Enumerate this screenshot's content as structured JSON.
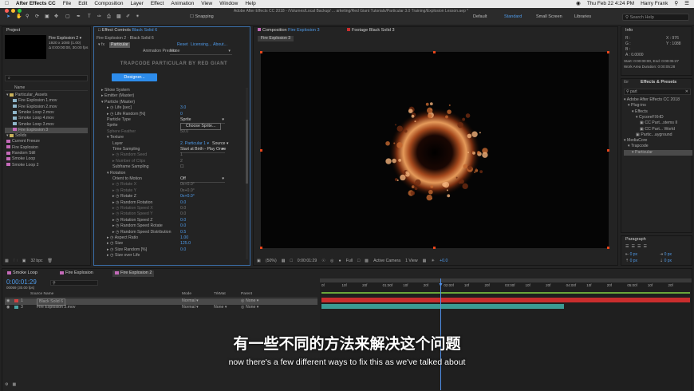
{
  "menubar": {
    "app": "After Effects CC",
    "items": [
      "File",
      "Edit",
      "Composition",
      "Layer",
      "Effect",
      "Animation",
      "View",
      "Window",
      "Help"
    ],
    "datetime": "Thu Feb 22  4:24 PM",
    "user": "Harry Frank"
  },
  "title": "Adobe After Effects CC 2018 - /Volumes/Local Backup/ ... arketing/Red Giant Tutorials/Particular 3.0 Training/Explosion Lesson.aep *",
  "toolbar": {
    "snapping": "Snapping",
    "workspaces": [
      "Default",
      "Standard",
      "Small Screen",
      "Libraries"
    ],
    "search_placeholder": "Search Help"
  },
  "project": {
    "tab": "Project",
    "item_name": "Fire Explosion 2 ▾",
    "item_size": "1920 x 1080 (1.00)",
    "item_dur": "Δ 0:00:00:00, 30.00 fps",
    "search_placeholder": "⌕",
    "header": "Name",
    "items": [
      {
        "name": "Particular_Assets",
        "kind": "folder",
        "indent": 0,
        "color": "#c9b15a"
      },
      {
        "name": "Fire Explosion 1.mov",
        "kind": "file",
        "indent": 1,
        "color": "#8fb6c9"
      },
      {
        "name": "Fire Explosion 2.mov",
        "kind": "file",
        "indent": 1,
        "color": "#8fb6c9"
      },
      {
        "name": "Smoke Loop 2.mov",
        "kind": "file",
        "indent": 1,
        "color": "#8fb6c9"
      },
      {
        "name": "Smoke Loop 4.mov",
        "kind": "file",
        "indent": 1,
        "color": "#8fb6c9"
      },
      {
        "name": "Smoke Loop 3.mov",
        "kind": "file",
        "indent": 1,
        "color": "#8fb6c9"
      },
      {
        "name": "Fire Explosion 3",
        "kind": "comp",
        "indent": 1,
        "color": "#c46ab9",
        "selected": true
      },
      {
        "name": "Solids",
        "kind": "folder",
        "indent": 0,
        "color": "#c9b15a"
      },
      {
        "name": "Current Freeze",
        "kind": "comp",
        "indent": 0,
        "color": "#c46ab9"
      },
      {
        "name": "Fire Explosion",
        "kind": "comp",
        "indent": 0,
        "color": "#c46ab9"
      },
      {
        "name": "Random Still",
        "kind": "comp",
        "indent": 0,
        "color": "#c46ab9"
      },
      {
        "name": "Smoke Loop",
        "kind": "comp",
        "indent": 0,
        "color": "#c46ab9"
      },
      {
        "name": "Smoke Loop 2",
        "kind": "comp",
        "indent": 0,
        "color": "#c46ab9"
      }
    ],
    "bpc": "32 bpc"
  },
  "effect_controls": {
    "tab_prefix": "Effect Controls",
    "tab_layer": "Black Solid 6",
    "path": "Fire Explosion 2 · Black Solid 6",
    "fx_name": "Particular",
    "reset": "Reset",
    "licensing": "Licensing...",
    "about": "About...",
    "presets_label": "Animation Presets:",
    "presets_value": "None",
    "brand": "TRAPCODE PARTICULAR BY RED GIANT",
    "designer": "Designer...",
    "rows": [
      {
        "label": "Show System",
        "indent": 0,
        "tri": "▸"
      },
      {
        "label": "Emitter (Master)",
        "indent": 0,
        "tri": "▸"
      },
      {
        "label": "Particle (Master)",
        "indent": 0,
        "tri": "▾"
      },
      {
        "label": "Life [sec]",
        "indent": 1,
        "tri": "▸",
        "sw": true,
        "value": "3.0"
      },
      {
        "label": "Life Random [%]",
        "indent": 1,
        "tri": "▸",
        "sw": true,
        "value": "0"
      },
      {
        "label": "Particle Type",
        "indent": 1,
        "value": "Sprite",
        "dropdown": true
      },
      {
        "label": "Sprite",
        "indent": 1,
        "button": "Choose Sprite..."
      },
      {
        "label": "Sphere Feather",
        "indent": 1,
        "value": "50.0",
        "disabled": true
      },
      {
        "label": "Texture",
        "indent": 1,
        "tri": "▾"
      },
      {
        "label": "Layer",
        "indent": 2,
        "value": "2. Particular 1 ▾",
        "extra": "Source ▾"
      },
      {
        "label": "Time Sampling",
        "indent": 2,
        "value": "Start at Birth - Play Once",
        "dropdown": true
      },
      {
        "label": "Random Seed",
        "indent": 2,
        "tri": "▸",
        "sw": true,
        "value": "1",
        "disabled": true
      },
      {
        "label": "Number of Clips",
        "indent": 2,
        "tri": "▸",
        "value": "2",
        "disabled": true
      },
      {
        "label": "Subframe Sampling",
        "indent": 2,
        "checkbox": true
      },
      {
        "label": "Rotation",
        "indent": 1,
        "tri": "▾"
      },
      {
        "label": "Orient to Motion",
        "indent": 2,
        "value": "Off",
        "dropdown": true
      },
      {
        "label": "Rotate X",
        "indent": 2,
        "tri": "▸",
        "sw": true,
        "value": "0x+0.0°",
        "disabled": true
      },
      {
        "label": "Rotate Y",
        "indent": 2,
        "tri": "▸",
        "sw": true,
        "value": "0x+0.0°",
        "disabled": true
      },
      {
        "label": "Rotate Z",
        "indent": 2,
        "tri": "▸",
        "sw": true,
        "value": "0x+0.0°"
      },
      {
        "label": "Random Rotation",
        "indent": 2,
        "tri": "▸",
        "sw": true,
        "value": "0.0"
      },
      {
        "label": "Rotation Speed X",
        "indent": 2,
        "tri": "▸",
        "sw": true,
        "value": "0.0",
        "disabled": true
      },
      {
        "label": "Rotation Speed Y",
        "indent": 2,
        "tri": "▸",
        "sw": true,
        "value": "0.0",
        "disabled": true
      },
      {
        "label": "Rotation Speed Z",
        "indent": 2,
        "tri": "▸",
        "sw": true,
        "value": "0.0"
      },
      {
        "label": "Random Speed Rotate",
        "indent": 2,
        "tri": "▸",
        "sw": true,
        "value": "0.0"
      },
      {
        "label": "Random Speed Distribution",
        "indent": 2,
        "tri": "▸",
        "sw": true,
        "value": "0.5"
      },
      {
        "label": "Aspect Ratio",
        "indent": 1,
        "tri": "▸",
        "sw": true,
        "value": "1.00"
      },
      {
        "label": "Size",
        "indent": 1,
        "tri": "▸",
        "sw": true,
        "value": "125.0"
      },
      {
        "label": "Size Random [%]",
        "indent": 1,
        "tri": "▸",
        "sw": true,
        "value": "0.0"
      },
      {
        "label": "Size over Life",
        "indent": 1,
        "tri": "▸",
        "sw": true
      }
    ]
  },
  "composition": {
    "tab_prefix": "Composition",
    "tab_name": "Fire Explosion 3",
    "footage_tab": "Footage Black Solid 3",
    "subtab": "Fire Explosion 3",
    "zoom": "(50%)",
    "time": "0:00:01:29",
    "resolution": "Full",
    "camera": "Active Camera",
    "view": "1 View",
    "exposure": "+0.0"
  },
  "info": {
    "tab": "Info",
    "r": "R :",
    "g": "G :",
    "b": "B :",
    "a": "A :  0.0000",
    "x": "X : 976",
    "y": "Y : 1088",
    "start": "Start: 0:00:00:00, End: 0:00:05:27",
    "duration": "Work Area Duration: 0:00:05:28"
  },
  "effects_presets": {
    "tab": "Effects & Presets",
    "left_tab": "ibr",
    "search": "part",
    "tree": [
      {
        "label": "Adobe After Effects CC 2018",
        "indent": 0
      },
      {
        "label": "Plug-ins",
        "indent": 1
      },
      {
        "label": "Effects",
        "indent": 2
      },
      {
        "label": "CycoreFXHD",
        "indent": 3
      },
      {
        "label": "CC Part...stems II",
        "indent": 4
      },
      {
        "label": "CC Part... World",
        "indent": 4
      },
      {
        "label": "Partic...ayground",
        "indent": 3
      },
      {
        "label": "MediaCore",
        "indent": 0
      },
      {
        "label": "Trapcode",
        "indent": 1
      },
      {
        "label": "Particular",
        "indent": 2,
        "selected": true
      }
    ]
  },
  "paragraph": {
    "tab": "Paragraph",
    "fields": [
      "0 px",
      "0 px",
      "0 px",
      "0 px",
      "0 px"
    ]
  },
  "timeline": {
    "tabs": [
      "Smoke Loop",
      "Fire Explosion",
      "Fire Explosion 2"
    ],
    "time": "0:00:01:29",
    "frames": "00059 (30.00 fps)",
    "cols": {
      "source": "Source Name",
      "mode": "Mode",
      "trkmat": "TrkMat",
      "parent": "Parent"
    },
    "layers": [
      {
        "num": "1",
        "name": "Black Solid 6",
        "mode": "Normal",
        "parent": "None",
        "color": "#d14141",
        "selected": true
      },
      {
        "num": "3",
        "name": "Fire Explosion 3.mov",
        "mode": "Normal",
        "trkmat": "None",
        "parent": "None",
        "color": "#49a3a3"
      }
    ],
    "ticks": [
      "0f",
      "10f",
      "20f",
      "01:00f",
      "10f",
      "20f",
      "02:00f",
      "10f",
      "20f",
      "03:00f",
      "10f",
      "20f",
      "04:00f",
      "10f",
      "20f",
      "05:00f",
      "10f",
      "20f"
    ]
  },
  "captions": {
    "zh": "有一些不同的方法来解决这个问题",
    "en": "now there's a few different ways to fix this as we've talked about"
  },
  "colors": {
    "accent": "#2d8ceb",
    "layer_red": "#c92d2d",
    "layer_teal": "#3b9a93",
    "playhead": "#4f8fe8"
  }
}
